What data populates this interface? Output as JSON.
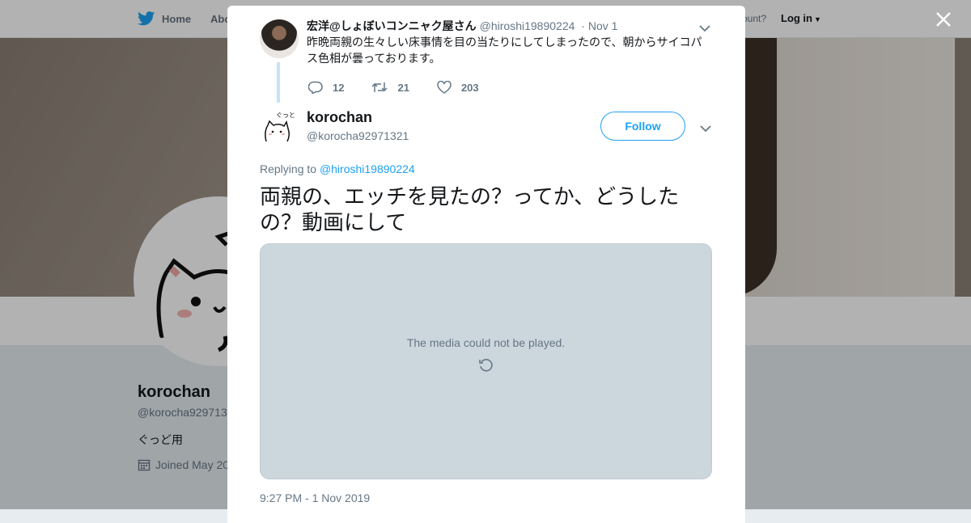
{
  "background_page": {
    "nav": {
      "home": "Home",
      "about": "Abo",
      "account_prompt": "ccount?",
      "login": "Log in"
    },
    "profile": {
      "name": "korochan",
      "handle": "@korocha929713",
      "bio": "ぐっど用",
      "joined": "Joined May 20"
    }
  },
  "modal": {
    "parent_tweet": {
      "name": "宏洋@しょぼいコンニャク屋さん",
      "handle": "@hiroshi19890224",
      "date": "· Nov 1",
      "text": "昨晩両親の生々しい床事情を目の当たりにしてしまったので、朝からサイコパス色相が曇っております。",
      "replies": "12",
      "retweets": "21",
      "likes": "203"
    },
    "tweet": {
      "name": "korochan",
      "handle": "@korocha92971321",
      "follow_label": "Follow",
      "replying_prefix": "Replying to",
      "replying_to": "@hiroshi19890224",
      "text": "両親の、エッチを見たの？ってか、どうしたの？動画にして",
      "media_message": "The media could not be played.",
      "timestamp": "9:27 PM - 1 Nov 2019"
    }
  },
  "colors": {
    "accent": "#1da1f2",
    "thread_line": "#c4e4f5",
    "media_bg": "#ccd6dd"
  }
}
